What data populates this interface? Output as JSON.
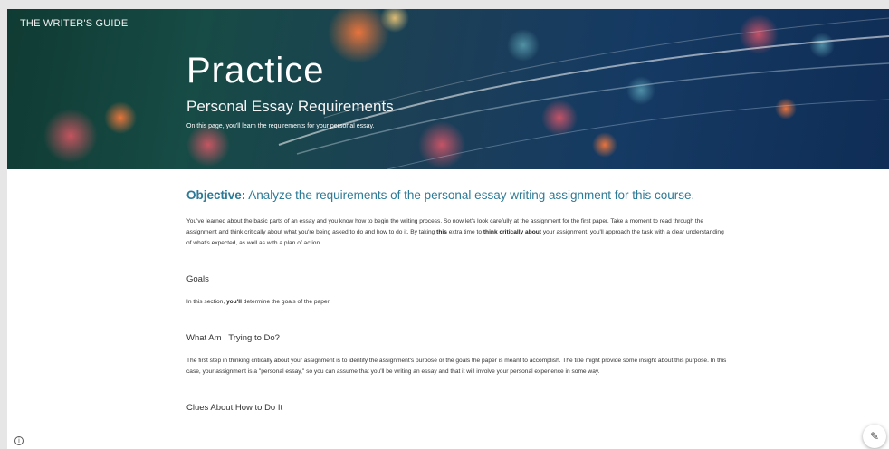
{
  "header": {
    "site_title": "THE WRITER'S GUIDE",
    "title": "Practice",
    "subtitle": "Personal Essay Requirements",
    "intro": "On this page, you'll learn the requirements for your personal essay."
  },
  "objective": {
    "label": "Objective:",
    "text": " Analyze the requirements of the personal essay writing assignment for this course."
  },
  "intro_paragraph": {
    "p1": "You've learned about the basic parts of an essay and you know how to begin the writing process. So now let's look carefully at the assignment for the first paper. Take a moment to read through the assignment and think critically about what you're being asked to do and how to do it. By taking ",
    "b1": "this",
    "p2": " extra time to ",
    "b2": "think critically about",
    "p3": " your assignment, you'll approach the task with a clear understanding of what's expected, as well as with a plan of action."
  },
  "goals": {
    "heading": "Goals",
    "p1": "In this section, ",
    "b1": "you'll",
    "p2": " determine the goals of the paper."
  },
  "trying": {
    "heading": "What Am I Trying to Do?",
    "text": "The first step in thinking critically about your assignment is to identify the assignment's purpose or the goals the paper is meant to accomplish. The title might provide some insight about this purpose. In this case, your assignment is a \"personal essay,\" so you can assume that you'll be writing an essay and that it will involve your personal experience in some way."
  },
  "clues": {
    "heading": "Clues About How to Do It"
  },
  "icons": {
    "info": "info-icon",
    "edit": "pencil-icon"
  }
}
